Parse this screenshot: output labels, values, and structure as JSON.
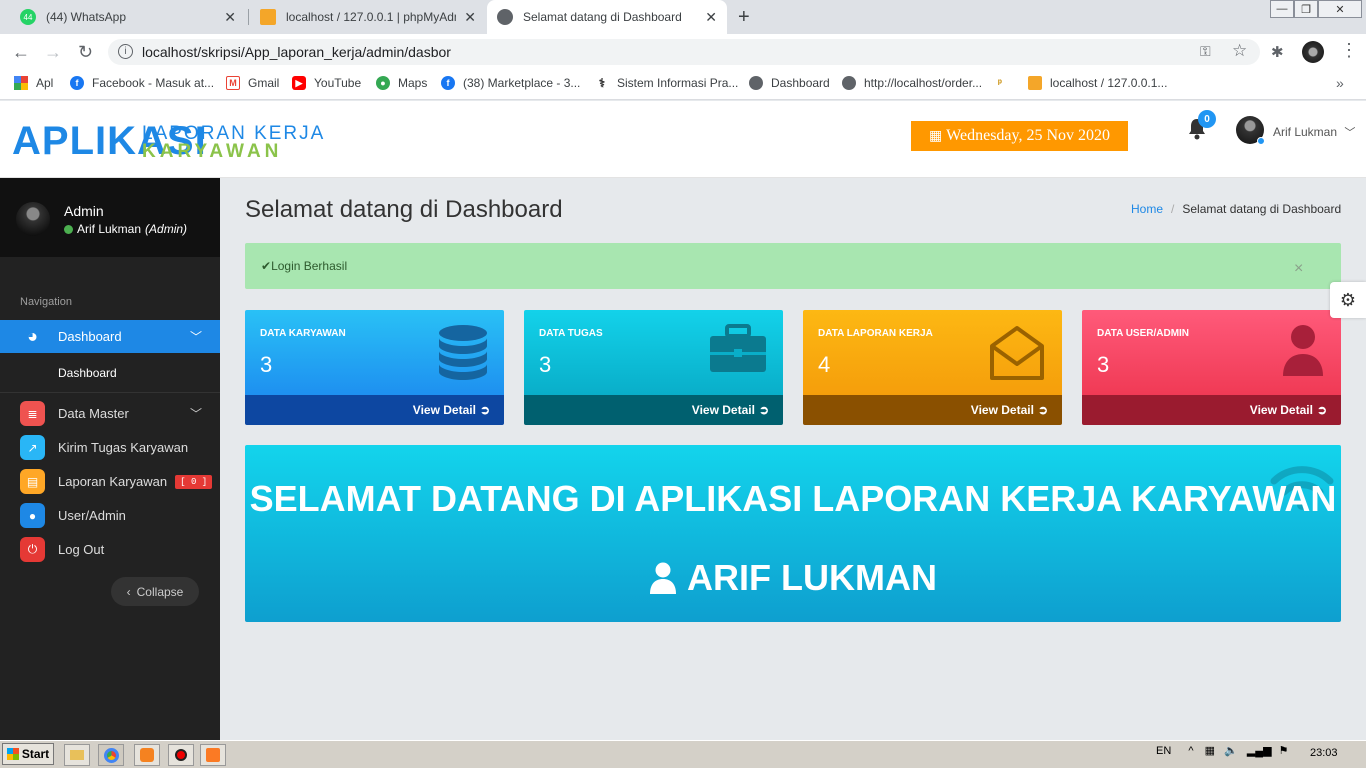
{
  "browser": {
    "tabs": [
      {
        "title": "(44) WhatsApp",
        "badge": "44"
      },
      {
        "title": "localhost / 127.0.0.1 | phpMyAdmin"
      },
      {
        "title": "Selamat datang di Dashboard",
        "active": true
      }
    ],
    "new_tab": "+",
    "url": "localhost/skripsi/App_laporan_kerja/admin/dasbor",
    "bookmarks": [
      "Apl",
      "Facebook - Masuk at...",
      "Gmail",
      "YouTube",
      "Maps",
      "(38) Marketplace - 3...",
      "Sistem Informasi Pra...",
      "Dashboard",
      "http://localhost/order...",
      "localhost / 127.0.0.1..."
    ]
  },
  "header": {
    "logo_main": "APLIKASI",
    "logo_line1": "LAPORAN KERJA",
    "logo_line2": "KARYAWAN",
    "date": "Wednesday, 25 Nov 2020",
    "notif_count": "0",
    "user_name": "Arif Lukman"
  },
  "sidebar": {
    "role": "Admin",
    "user_name": "Arif Lukman",
    "user_role_tag": "(Admin)",
    "nav_label": "Navigation",
    "items": [
      {
        "label": "Dashboard",
        "color": "#1e88e5"
      },
      {
        "label": "Dashboard"
      },
      {
        "label": "Data Master",
        "color": "#ef5350"
      },
      {
        "label": "Kirim Tugas Karyawan",
        "color": "#29b6f6"
      },
      {
        "label": "Laporan Karyawan",
        "color": "#ffa726",
        "badge": "[ 0 ]"
      },
      {
        "label": "User/Admin",
        "color": "#1e88e5"
      },
      {
        "label": "Log Out",
        "color": "#e53935"
      }
    ],
    "collapse": "Collapse"
  },
  "main": {
    "title": "Selamat datang di Dashboard",
    "breadcrumb": {
      "home": "Home",
      "separator": "/",
      "current": "Selamat datang di Dashboard"
    },
    "alert": "Login Berhasil",
    "alert_close": "×",
    "cards": [
      {
        "label": "DATA KARYAWAN",
        "value": "3",
        "link": "View Detail",
        "icon": "database-icon",
        "top": "#20b6f3",
        "bottom": "#0d47a1"
      },
      {
        "label": "DATA TUGAS",
        "value": "3",
        "link": "View Detail",
        "icon": "briefcase-icon",
        "top": "#12c9e0",
        "bottom": "#00606f"
      },
      {
        "label": "DATA LAPORAN KERJA",
        "value": "4",
        "link": "View Detail",
        "icon": "envelope-open-icon",
        "top": "#fdb813",
        "bottom": "#8a5000"
      },
      {
        "label": "DATA USER/ADMIN",
        "value": "3",
        "link": "View Detail",
        "icon": "user-icon",
        "top": "#ff4d6d",
        "bottom": "#9a1b2f"
      }
    ],
    "banner_title": "SELAMAT DATANG DI APLIKASI LAPORAN KERJA KARYAWAN",
    "banner_user": "ARIF LUKMAN"
  },
  "taskbar": {
    "start": "Start",
    "lang": "EN",
    "clock": "23:03"
  }
}
